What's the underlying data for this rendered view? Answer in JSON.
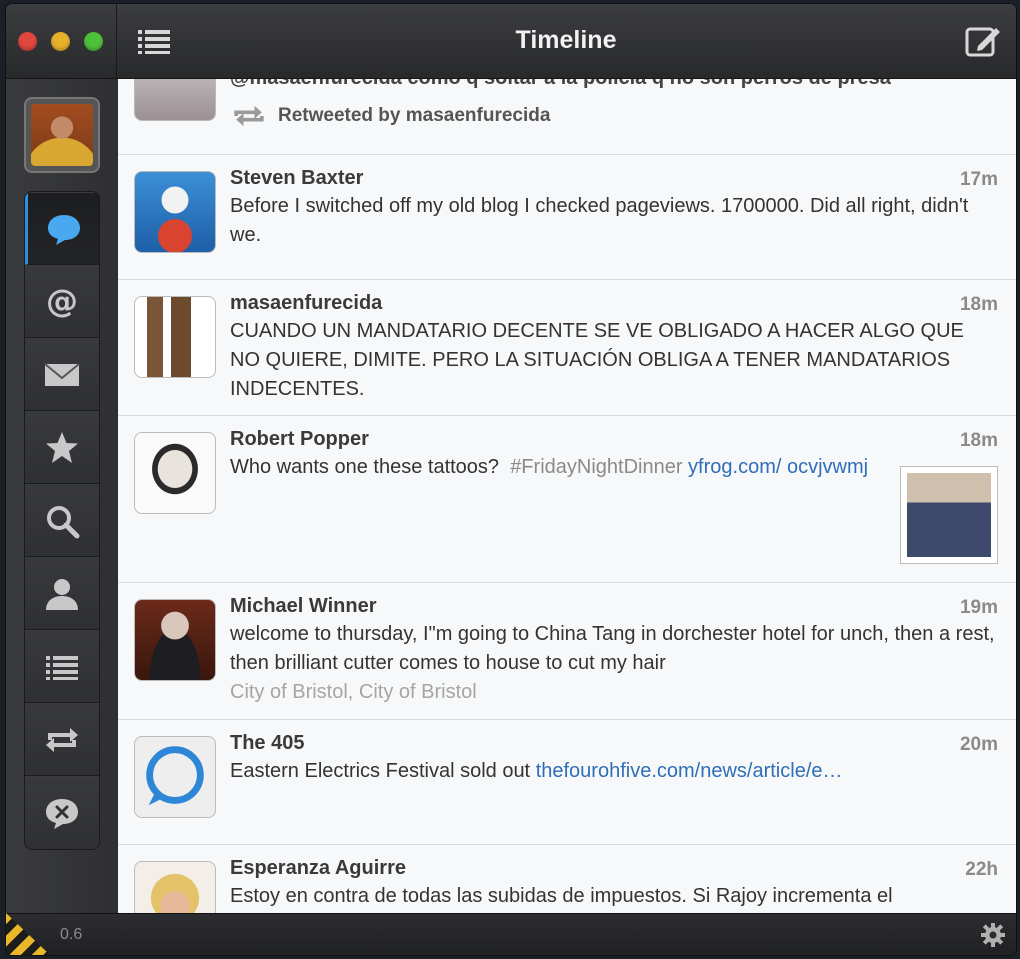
{
  "window": {
    "title": "Timeline"
  },
  "status": {
    "version": "0.6"
  },
  "retweet_partial": {
    "cut_text": "@masaenfurecida como q soltar a la policía q no son perros de presa",
    "retweeted_by": "Retweeted by masaenfurecida"
  },
  "tweets": [
    {
      "name": "Steven Baxter",
      "time": "17m",
      "text": "Before I switched off my old blog I checked pageviews. 1700000. Did all right, didn't we."
    },
    {
      "name": "masaenfurecida",
      "time": "18m",
      "text": "CUANDO UN MANDATARIO DECENTE SE VE OBLIGADO A HACER ALGO QUE NO QUIERE, DIMITE. PERO LA SITUACIÓN OBLIGA A TENER MANDATARIOS INDECENTES."
    },
    {
      "name": "Robert Popper",
      "time": "18m",
      "text": "Who wants one these tattoos?",
      "hashtag": "#FridayNightDinner",
      "link": "yfrog.com/ ocvjvwmj"
    },
    {
      "name": "Michael Winner",
      "time": "19m",
      "text": "welcome to thursday, I\"m going to China Tang in dorchester hotel for unch, then a rest, then brilliant cutter comes to house to cut my hair",
      "location": "City of Bristol, City of Bristol"
    },
    {
      "name": "The 405",
      "time": "20m",
      "text": "Eastern Electrics Festival sold out",
      "link": "thefourohfive.com/news/article/e…"
    },
    {
      "name": "Esperanza Aguirre",
      "time": "22h",
      "text": "Estoy en contra de todas las subidas de impuestos. Si Rajoy incrementa el"
    }
  ],
  "colors": {
    "accent": "#2e8fe0",
    "link": "#2f6fb7",
    "hashtag": "#8a8a8a"
  },
  "nav_icons": [
    "speech-bubble-icon",
    "at-sign-icon",
    "envelope-icon",
    "star-icon",
    "search-icon",
    "person-icon",
    "list-icon",
    "retweet-icon",
    "muted-bubble-icon"
  ]
}
